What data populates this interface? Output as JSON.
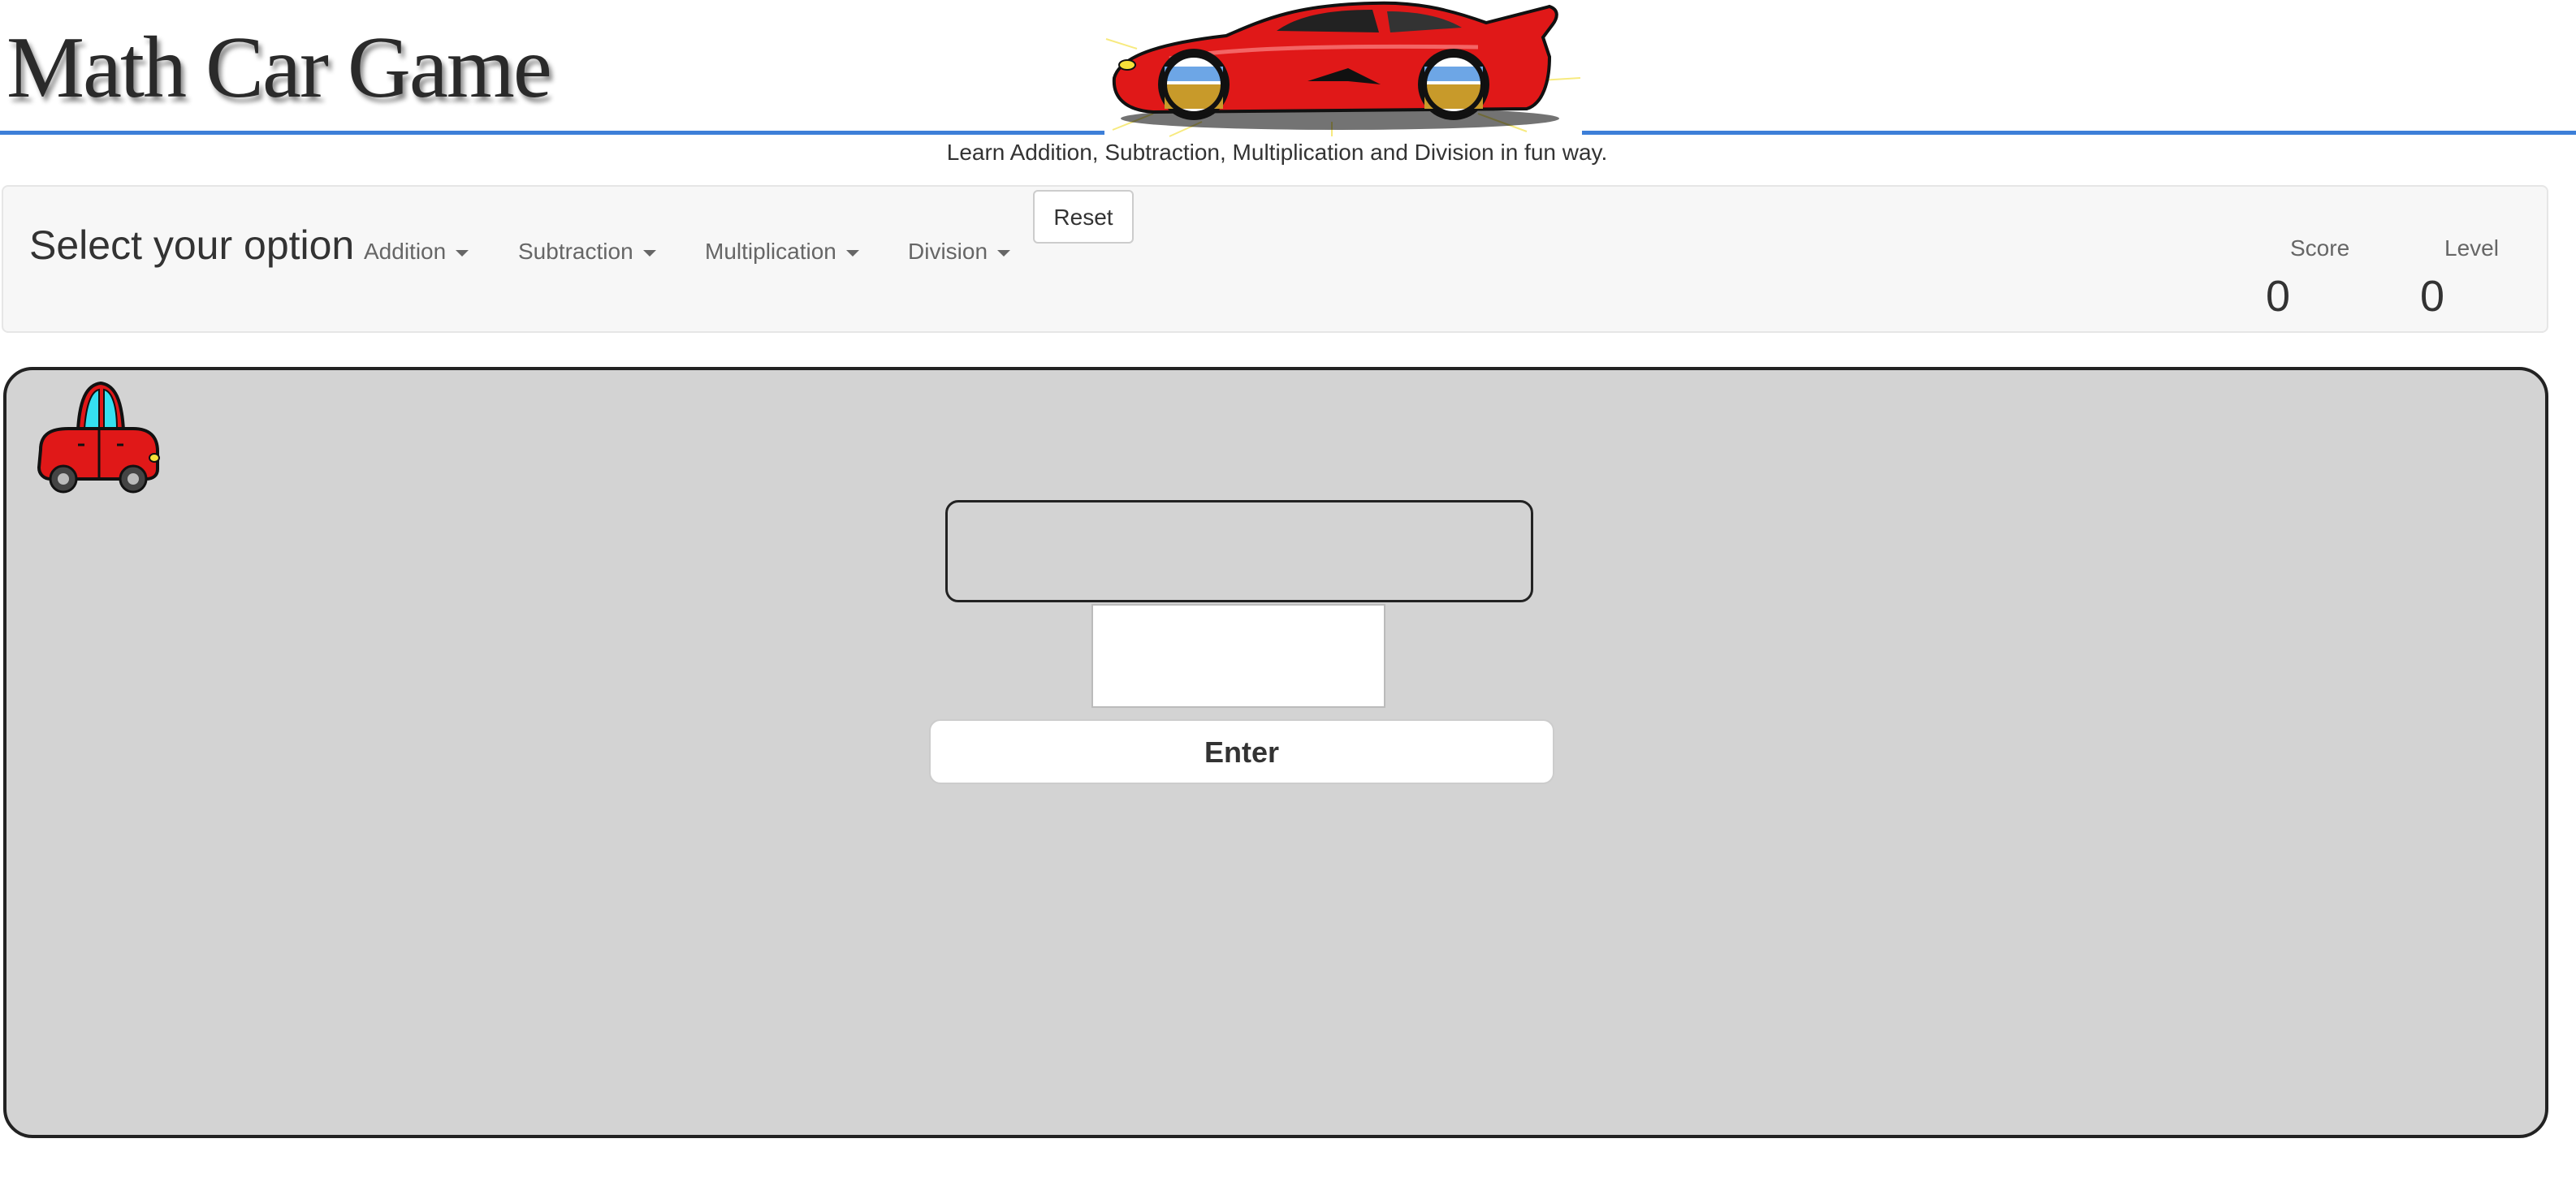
{
  "header": {
    "title": "Math Car Game",
    "tagline": "Learn Addition, Subtraction, Multiplication and Division in fun way.",
    "accent_color": "#3d7fd8"
  },
  "navbar": {
    "brand": "Select your option",
    "menus": [
      {
        "label": "Addition",
        "icon": "caret-down-icon"
      },
      {
        "label": "Subtraction",
        "icon": "caret-down-icon"
      },
      {
        "label": "Multiplication",
        "icon": "caret-down-icon"
      },
      {
        "label": "Division",
        "icon": "caret-down-icon"
      }
    ],
    "reset_label": "Reset",
    "score_label": "Score",
    "score_value": "0",
    "level_label": "Level",
    "level_value": "0"
  },
  "game": {
    "background_color": "#d3d3d3",
    "question_text": "",
    "answer_value": "",
    "enter_label": "Enter",
    "player_icon": "red-car-icon"
  }
}
